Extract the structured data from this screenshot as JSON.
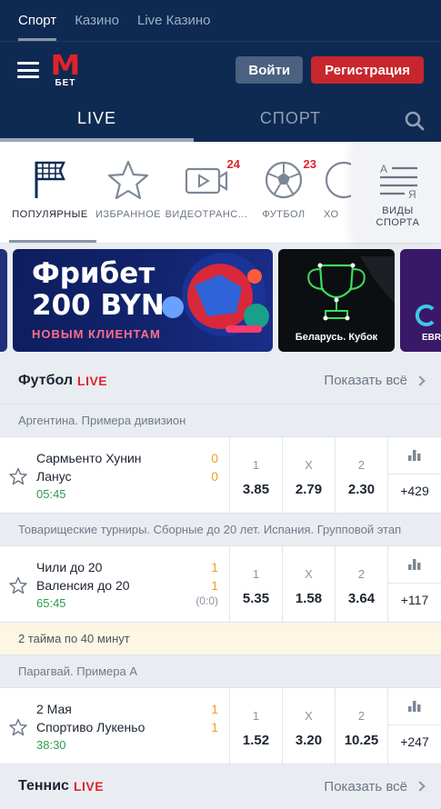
{
  "top_tabs": [
    "Спорт",
    "Казино",
    "Live Казино"
  ],
  "header": {
    "logo_letter": "M",
    "logo_sub": "БЕТ",
    "login": "Войти",
    "register": "Регистрация"
  },
  "mode_tabs": [
    "LIVE",
    "СПОРТ"
  ],
  "sports": [
    {
      "label": "ПОПУЛЯРНЫЕ",
      "icon": "flag-grid-icon",
      "badge": ""
    },
    {
      "label": "ИЗБРАННОЕ",
      "icon": "star-icon",
      "badge": ""
    },
    {
      "label": "ВИДЕОТРАНС...",
      "icon": "video-icon",
      "badge": "24"
    },
    {
      "label": "ФУТБОЛ",
      "icon": "soccer-ball-icon",
      "badge": "23"
    },
    {
      "label": "ХО",
      "icon": "hockey-icon",
      "badge": ""
    }
  ],
  "sport_types": {
    "line1": "ВИДЫ",
    "line2": "СПОРТА",
    "icon_letters": [
      "А",
      "Я"
    ]
  },
  "banners": {
    "main": {
      "line1": "Фрибет",
      "line2": "200 BYN",
      "line3": "НОВЫМ КЛИЕНТАМ"
    },
    "cup": {
      "caption": "Беларусь. Кубок"
    },
    "ebr": {
      "caption": "EBR"
    }
  },
  "football": {
    "title": "Футбол",
    "live": "LIVE",
    "show_all": "Показать всё",
    "leagues": [
      {
        "name": "Аргентина. Примера дивизион",
        "match": {
          "team1": "Сармьенто Хунин",
          "team2": "Ланус",
          "score1": "0",
          "score2": "0",
          "time": "05:45",
          "extra": "",
          "odds": [
            {
              "k": "1",
              "v": "3.85"
            },
            {
              "k": "X",
              "v": "2.79"
            },
            {
              "k": "2",
              "v": "2.30"
            }
          ],
          "more": "+429"
        },
        "note": ""
      },
      {
        "name": "Товарищеские турниры. Сборные до 20 лет. Испания. Групповой этап",
        "match": {
          "team1": "Чили до 20",
          "team2": "Валенсия до 20",
          "score1": "1",
          "score2": "1",
          "time": "65:45",
          "extra": "(0:0)",
          "odds": [
            {
              "k": "1",
              "v": "5.35"
            },
            {
              "k": "X",
              "v": "1.58"
            },
            {
              "k": "2",
              "v": "3.64"
            }
          ],
          "more": "+117"
        },
        "note": "2 тайма по 40 минут"
      },
      {
        "name": "Парагвай. Примера А",
        "match": {
          "team1": "2 Мая",
          "team2": "Спортиво Лукеньо",
          "score1": "1",
          "score2": "1",
          "time": "38:30",
          "extra": "",
          "odds": [
            {
              "k": "1",
              "v": "1.52"
            },
            {
              "k": "X",
              "v": "3.20"
            },
            {
              "k": "2",
              "v": "10.25"
            }
          ],
          "more": "+247"
        },
        "note": ""
      }
    ]
  },
  "tennis": {
    "title": "Теннис",
    "live": "LIVE",
    "show_all": "Показать всё"
  },
  "colors": {
    "navy": "#0e2a52",
    "red": "#e0222b",
    "green": "#2e9a4c",
    "score": "#f0a020"
  }
}
